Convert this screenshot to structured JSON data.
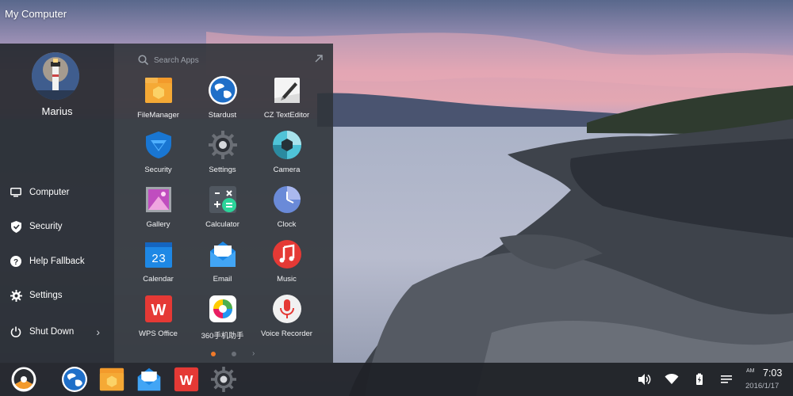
{
  "desktop": {
    "title": "My Computer"
  },
  "user": {
    "name": "Marius"
  },
  "nav": [
    {
      "label": "Computer",
      "icon": "monitor-icon"
    },
    {
      "label": "Security",
      "icon": "shield-icon"
    },
    {
      "label": "Help Fallback",
      "icon": "help-icon"
    },
    {
      "label": "Settings",
      "icon": "gear-icon"
    },
    {
      "label": "Shut Down",
      "icon": "power-icon"
    }
  ],
  "search": {
    "placeholder": "Search Apps"
  },
  "apps": [
    {
      "label": "FileManager",
      "icon": "folder-icon"
    },
    {
      "label": "Stardust",
      "icon": "globe-icon"
    },
    {
      "label": "CZ TextEditor",
      "icon": "text-editor-icon"
    },
    {
      "label": "Security",
      "icon": "shield-app-icon"
    },
    {
      "label": "Settings",
      "icon": "gear-app-icon"
    },
    {
      "label": "Camera",
      "icon": "camera-icon"
    },
    {
      "label": "Gallery",
      "icon": "gallery-icon"
    },
    {
      "label": "Calculator",
      "icon": "calculator-icon"
    },
    {
      "label": "Clock",
      "icon": "clock-icon"
    },
    {
      "label": "Calendar",
      "icon": "calendar-icon"
    },
    {
      "label": "Email",
      "icon": "email-icon"
    },
    {
      "label": "Music",
      "icon": "music-icon"
    },
    {
      "label": "WPS Office",
      "icon": "wps-icon"
    },
    {
      "label": "360手机助手",
      "icon": "360-assistant-icon"
    },
    {
      "label": "Voice Recorder",
      "icon": "microphone-icon"
    }
  ],
  "calendar_icon_text": "23",
  "wps_icon_text": "W",
  "pagination": {
    "pages": 2,
    "current": 1
  },
  "taskbar": {
    "pinned": [
      "start-logo-icon",
      "globe-icon",
      "folder-icon",
      "email-icon",
      "wps-icon",
      "gear-icon"
    ],
    "tray": [
      "volume-icon",
      "wifi-icon",
      "battery-icon",
      "notifications-icon"
    ],
    "clock": {
      "ampm": "AM",
      "time": "7:03",
      "date": "2016/1/17"
    }
  },
  "colors": {
    "accent": "#f07a2a",
    "menu_left": "#262a30",
    "menu_right": "#30343a",
    "taskbar": "#1e2126"
  }
}
